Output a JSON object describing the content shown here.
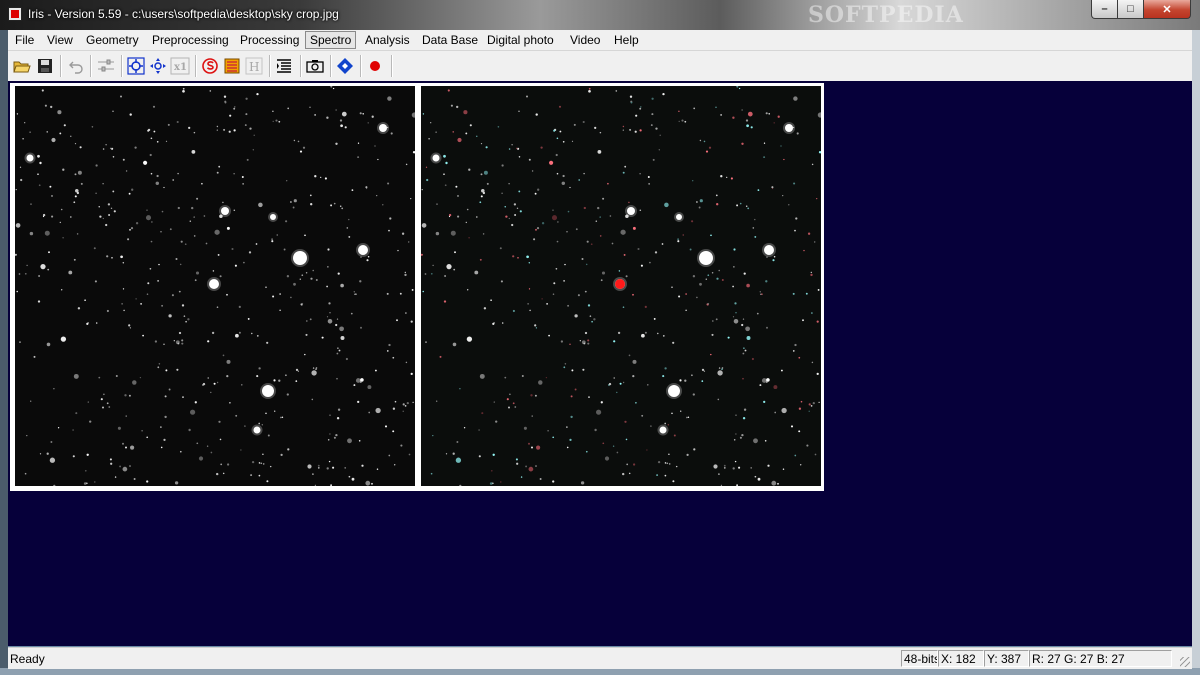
{
  "window": {
    "title": "Iris - Version 5.59 - c:\\users\\softpedia\\desktop\\sky crop.jpg",
    "watermark": "SOFTPEDIA",
    "controls": {
      "minimize": "–",
      "maximize": "□",
      "close": "✕"
    }
  },
  "menu": [
    {
      "label": "File"
    },
    {
      "label": "View"
    },
    {
      "label": "Geometry"
    },
    {
      "label": "Preprocessing"
    },
    {
      "label": "Processing"
    },
    {
      "label": "Spectro"
    },
    {
      "label": "Analysis"
    },
    {
      "label": "Data Base"
    },
    {
      "label": "Digital photo"
    },
    {
      "label": "Video"
    },
    {
      "label": "Help"
    }
  ],
  "toolbar": {
    "buttons": [
      {
        "icon": "open-folder-icon"
      },
      {
        "icon": "save-disk-icon"
      },
      {
        "icon": "undo-icon",
        "disabled": true
      },
      {
        "icon": "settings-sliders-icon",
        "disabled": true
      },
      {
        "icon": "zoom-in-icon"
      },
      {
        "icon": "zoom-out-icon"
      },
      {
        "icon": "zoom-x1-icon",
        "label": "x1",
        "disabled": true
      },
      {
        "icon": "threshold-icon"
      },
      {
        "icon": "palette-icon"
      },
      {
        "icon": "histogram-icon",
        "label": "H",
        "disabled": true
      },
      {
        "icon": "list-icon"
      },
      {
        "icon": "camera-icon"
      },
      {
        "icon": "diamond-icon"
      },
      {
        "icon": "red-dot-icon"
      }
    ]
  },
  "workspace": {
    "background": "#06003a",
    "images": [
      {
        "name": "grayscale-sky"
      },
      {
        "name": "color-sky"
      }
    ],
    "marker_color": "#ff1a1a"
  },
  "status": {
    "text": "Ready",
    "bit_depth": "48-bits",
    "x": "X: 182",
    "y": "Y: 387",
    "rgb": "R: 27  G: 27  B: 27"
  }
}
